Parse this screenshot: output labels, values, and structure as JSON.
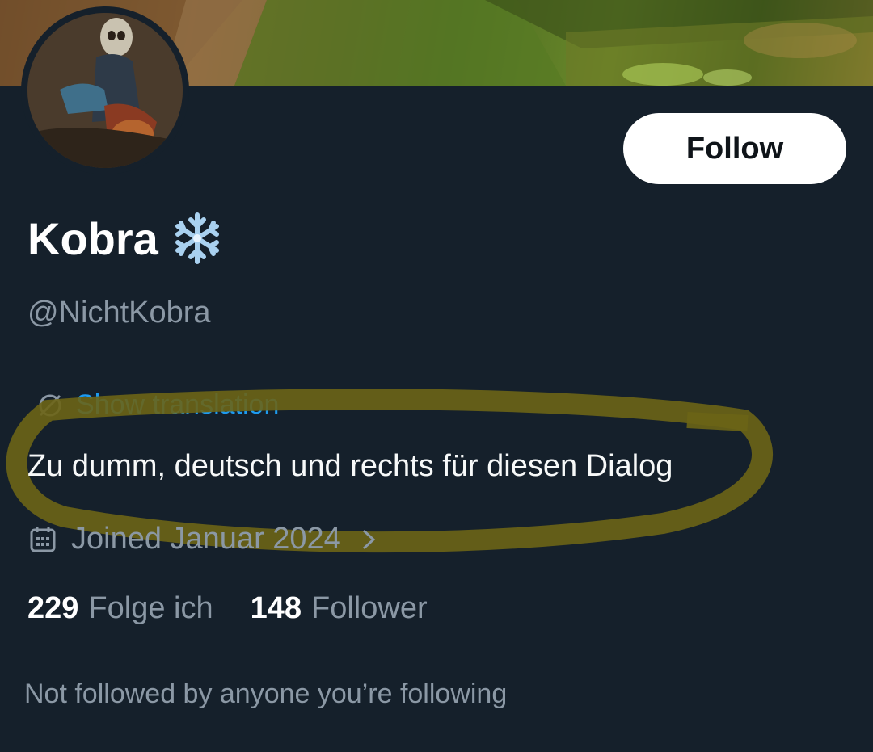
{
  "profile": {
    "display_name": "Kobra",
    "handle": "@NichtKobra",
    "emoji_icon": "snowflake-icon",
    "follow_label": "Follow"
  },
  "bio": {
    "translation_label": "Show translation",
    "text": "Zu dumm, deutsch und rechts für diesen Dialog"
  },
  "joined": {
    "label": "Joined Januar 2024"
  },
  "stats": {
    "following_count": "229",
    "following_label": "Folge ich",
    "followers_count": "148",
    "followers_label": "Follower"
  },
  "followed_by": {
    "text": "Not followed by anyone you’re following"
  },
  "colors": {
    "background": "#15202b",
    "accent": "#1d9bf0",
    "muted_text": "#8b98a5",
    "highlight_marker": "#6b6416"
  }
}
